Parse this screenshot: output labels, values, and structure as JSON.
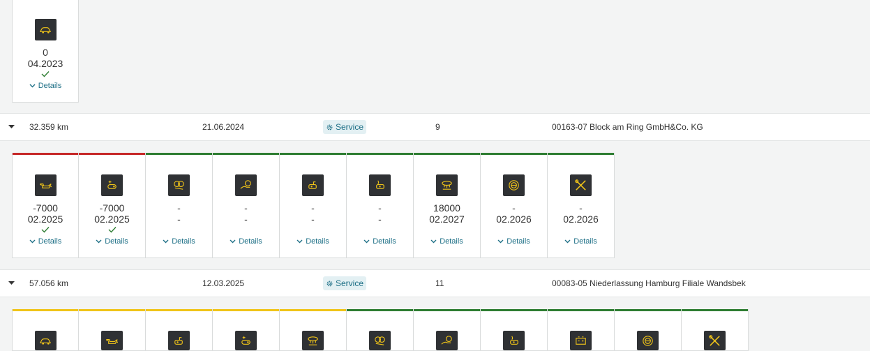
{
  "colors": {
    "red": "#c62828",
    "green": "#2e7d32",
    "yellow": "#f0c419",
    "link": "#1d6f86",
    "icon_bg": "#2f3134",
    "icon_fg": "#f0c419"
  },
  "details_label": "Details",
  "group0": {
    "cards": [
      {
        "icon": "car-icon",
        "value": "0",
        "date": "04.2023",
        "check": true,
        "status": "none"
      }
    ]
  },
  "rows": [
    {
      "mileage": "32.359 km",
      "date": "21.06.2024",
      "badge": "Service",
      "count": "9",
      "dealer": "00163-07 Block am Ring GmbH&Co. KG"
    },
    {
      "mileage": "57.056 km",
      "date": "12.03.2025",
      "badge": "Service",
      "count": "11",
      "dealer": "00083-05 Niederlassung Hamburg Filiale Wandsbek"
    }
  ],
  "group1": {
    "cards": [
      {
        "icon": "oil-can-icon",
        "value": "-7000",
        "date": "02.2025",
        "check": true,
        "status": "red"
      },
      {
        "icon": "brake-fluid-icon",
        "value": "-7000",
        "date": "02.2025",
        "check": true,
        "status": "red"
      },
      {
        "icon": "brake-pad-front-icon",
        "value": "-",
        "date": "-",
        "check": false,
        "status": "green"
      },
      {
        "icon": "brake-pad-rear-icon",
        "value": "-",
        "date": "-",
        "check": false,
        "status": "green"
      },
      {
        "icon": "fluid-can-icon",
        "value": "-",
        "date": "-",
        "check": false,
        "status": "green"
      },
      {
        "icon": "coolant-icon",
        "value": "-",
        "date": "-",
        "check": false,
        "status": "green"
      },
      {
        "icon": "air-filter-icon",
        "value": "18000",
        "date": "02.2027",
        "check": false,
        "status": "green"
      },
      {
        "icon": "brake-disc-icon",
        "value": "-",
        "date": "02.2026",
        "check": false,
        "status": "green"
      },
      {
        "icon": "tools-icon",
        "value": "-",
        "date": "02.2026",
        "check": false,
        "status": "green"
      }
    ]
  },
  "group2": {
    "cards": [
      {
        "icon": "car-icon",
        "status": "yellow"
      },
      {
        "icon": "oil-can-icon",
        "status": "yellow"
      },
      {
        "icon": "fluid-can-icon",
        "status": "yellow"
      },
      {
        "icon": "brake-fluid-icon",
        "status": "yellow"
      },
      {
        "icon": "air-filter-icon",
        "status": "yellow"
      },
      {
        "icon": "brake-pad-front-icon",
        "status": "green"
      },
      {
        "icon": "brake-pad-rear-icon",
        "status": "green"
      },
      {
        "icon": "coolant-icon",
        "status": "green"
      },
      {
        "icon": "battery-icon",
        "status": "green"
      },
      {
        "icon": "brake-disc-icon",
        "status": "green"
      },
      {
        "icon": "tools-icon",
        "status": "green"
      }
    ]
  }
}
